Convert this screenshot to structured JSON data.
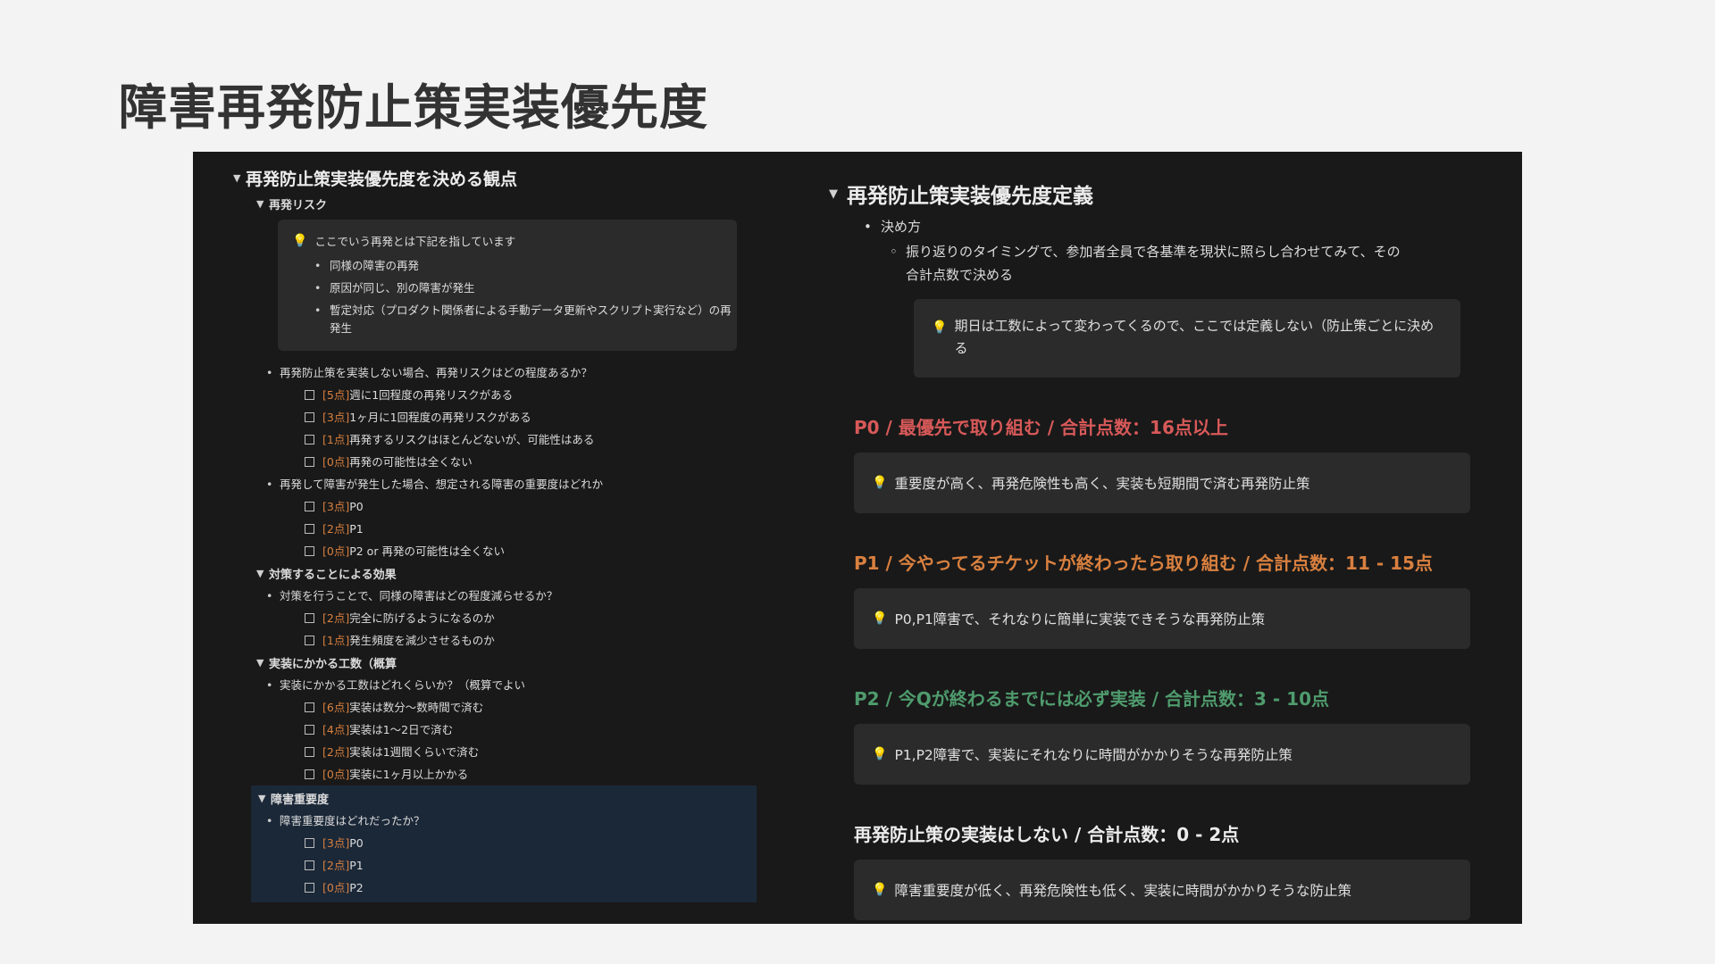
{
  "slide_title": "障害再発防止策実装優先度",
  "left": {
    "heading": "再発防止策実装優先度を決める観点",
    "sections": {
      "risk": {
        "title": "再発リスク",
        "callout_head": "ここでいう再発とは下記を指しています",
        "callout_items": [
          "同様の障害の再発",
          "原因が同じ、別の障害が発生",
          "暫定対応（プロダクト関係者による手動データ更新やスクリプト実行など）の再発生"
        ],
        "q1": "再発防止策を実装しない場合、再発リスクはどの程度あるか？",
        "q1_options": [
          {
            "pts": "[5点]",
            "text": "週に1回程度の再発リスクがある"
          },
          {
            "pts": "[3点]",
            "text": "1ヶ月に1回程度の再発リスクがある"
          },
          {
            "pts": "[1点]",
            "text": "再発するリスクはほとんどないが、可能性はある"
          },
          {
            "pts": "[0点]",
            "text": "再発の可能性は全くない"
          }
        ],
        "q2": "再発して障害が発生した場合、想定される障害の重要度はどれか",
        "q2_options": [
          {
            "pts": "[3点]",
            "text": "P0"
          },
          {
            "pts": "[2点]",
            "text": "P1"
          },
          {
            "pts": "[0点]",
            "text": "P2 or 再発の可能性は全くない"
          }
        ]
      },
      "effect": {
        "title": "対策することによる効果",
        "q": "対策を行うことで、同様の障害はどの程度減らせるか？",
        "options": [
          {
            "pts": "[2点]",
            "text": "完全に防げるようになるのか"
          },
          {
            "pts": "[1点]",
            "text": "発生頻度を減少させるものか"
          }
        ]
      },
      "cost": {
        "title": "実装にかかる工数（概算",
        "q": "実装にかかる工数はどれくらいか？（概算でよい",
        "options": [
          {
            "pts": "[6点]",
            "text": "実装は数分〜数時間で済む"
          },
          {
            "pts": "[4点]",
            "text": "実装は1〜2日で済む"
          },
          {
            "pts": "[2点]",
            "text": "実装は1週間くらいで済む"
          },
          {
            "pts": "[0点]",
            "text": "実装に1ヶ月以上かかる"
          }
        ]
      },
      "severity": {
        "title": "障害重要度",
        "q": "障害重要度はどれだったか？",
        "options": [
          {
            "pts": "[3点]",
            "text": "P0"
          },
          {
            "pts": "[2点]",
            "text": "P1"
          },
          {
            "pts": "[0点]",
            "text": "P2"
          }
        ]
      }
    }
  },
  "right": {
    "heading": "再発防止策実装優先度定義",
    "bullet": "決め方",
    "sub_bullet": "振り返りのタイミングで、参加者全員で各基準を現状に照らし合わせてみて、その合計点数で決める",
    "note": "期日は工数によって変わってくるので、ここでは定義しない（防止策ごとに決める",
    "levels": [
      {
        "heading": "P0 / 最優先で取り組む / 合計点数：16点以上",
        "desc": "重要度が高く、再発危険性も高く、実装も短期間で済む再発防止策",
        "color": "#d85959"
      },
      {
        "heading": "P1 / 今やってるチケットが終わったら取り組む / 合計点数：11 - 15点",
        "desc": "P0,P1障害で、それなりに簡単に実装できそうな再発防止策",
        "color": "#d9803f"
      },
      {
        "heading": "P2 / 今Qが終わるまでには必ず実装 / 合計点数：3 - 10点",
        "desc": "P1,P2障害で、実装にそれなりに時間がかかりそうな再発防止策",
        "color": "#4f9b6d"
      },
      {
        "heading": "再発防止策の実装はしない / 合計点数：0 - 2点",
        "desc": "障害重要度が低く、再発危険性も低く、実装に時間がかかりそうな防止策",
        "color": "#ececec"
      }
    ]
  }
}
